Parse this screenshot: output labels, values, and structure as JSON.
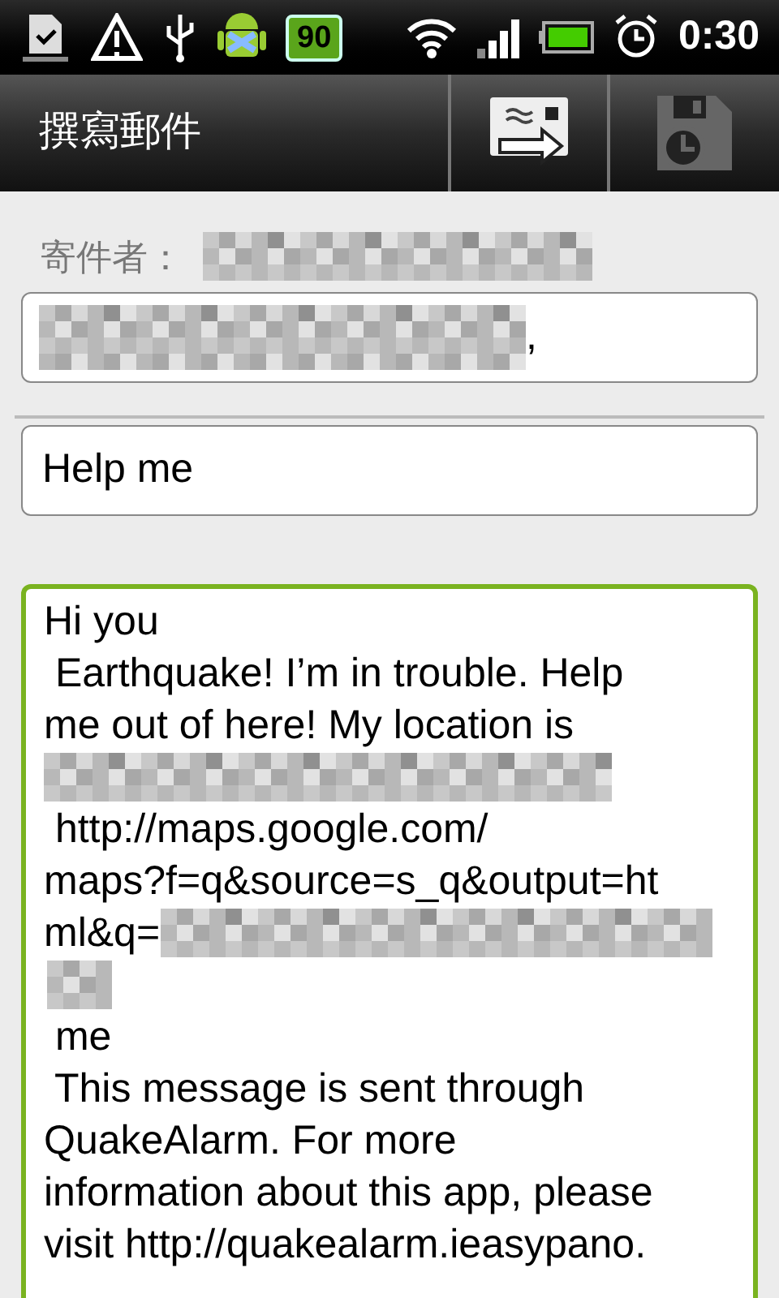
{
  "status_bar": {
    "battery_badge": "90",
    "time": "0:30"
  },
  "title_bar": {
    "title": "撰寫郵件"
  },
  "sender": {
    "label": "寄件者："
  },
  "to_field": {
    "value": ","
  },
  "subject_field": {
    "value": "Help me"
  },
  "body": {
    "focused": true,
    "lines": [
      {
        "kind": "text",
        "text": "Hi you"
      },
      {
        "kind": "text",
        "text": " Earthquake! I’m in trouble. Help"
      },
      {
        "kind": "text",
        "text": "me out of here! My location is"
      },
      {
        "kind": "redacted"
      },
      {
        "kind": "text",
        "text": " http://maps.google.com/"
      },
      {
        "kind": "text",
        "text": "maps?f=q&source=s_q&output=ht"
      },
      {
        "kind": "text_redacted",
        "text": "ml&q="
      },
      {
        "kind": "redacted_short"
      },
      {
        "kind": "text",
        "text": " me"
      },
      {
        "kind": "text",
        "text": " This message is sent through"
      },
      {
        "kind": "text",
        "text": "QuakeAlarm. For more"
      },
      {
        "kind": "text",
        "text": "information about this app, please"
      },
      {
        "kind": "text",
        "text": "visit http://quakealarm.ieasypano."
      }
    ]
  }
}
